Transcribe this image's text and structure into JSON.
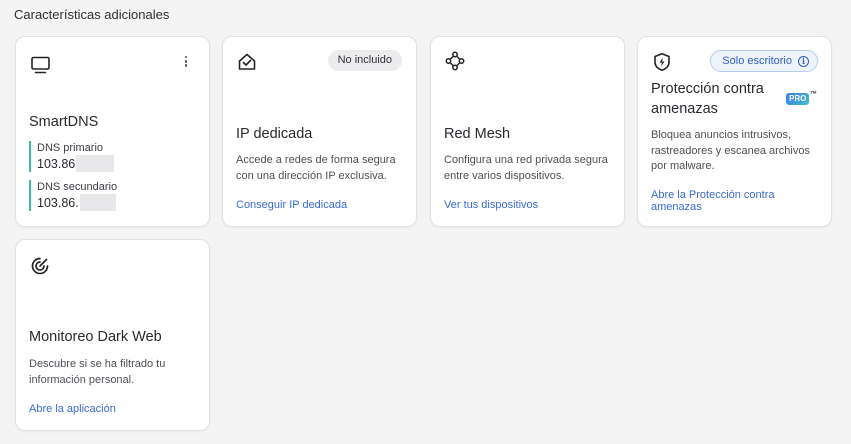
{
  "section_title": "Características adicionales",
  "cards": {
    "smartdns": {
      "title": "SmartDNS",
      "icon": "monitor-icon",
      "primary_label": "DNS primario",
      "primary_value": "103.86",
      "secondary_label": "DNS secundario",
      "secondary_value": "103.86."
    },
    "dedicated_ip": {
      "title": "IP dedicada",
      "icon": "home-shield-icon",
      "badge": "No incluido",
      "desc": "Accede a redes de forma segura con una dirección IP exclusiva.",
      "link": "Conseguir IP dedicada"
    },
    "mesh": {
      "title": "Red Mesh",
      "icon": "mesh-network-icon",
      "desc": "Configura una red privada segura entre varios dispositivos.",
      "link": "Ver tus dispositivos"
    },
    "threat": {
      "title_line1": "Protección contra",
      "title_line2": "amenazas",
      "icon": "shield-bolt-icon",
      "badge": "Solo escritorio",
      "pro": "PRO",
      "tm": "™",
      "desc": "Bloquea anuncios intrusivos, rastreadores y escanea archivos por malware.",
      "link_line1": "Abre la Protección contra",
      "link_line2": "amenazas"
    },
    "darkweb": {
      "title": "Monitoreo Dark Web",
      "icon": "radar-icon",
      "desc": "Descubre si se ha filtrado tu información personal.",
      "link": "Abre la aplicación"
    }
  },
  "colors": {
    "accent_link": "#3a6ad6",
    "dns_bar": "#3fb8a6",
    "background": "#f4f4f5"
  }
}
